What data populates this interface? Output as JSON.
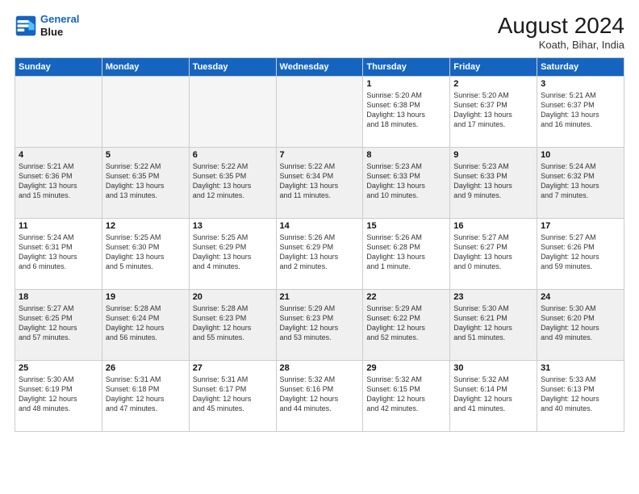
{
  "header": {
    "logo_line1": "General",
    "logo_line2": "Blue",
    "month_year": "August 2024",
    "location": "Koath, Bihar, India"
  },
  "weekdays": [
    "Sunday",
    "Monday",
    "Tuesday",
    "Wednesday",
    "Thursday",
    "Friday",
    "Saturday"
  ],
  "weeks": [
    [
      {
        "day": "",
        "info": ""
      },
      {
        "day": "",
        "info": ""
      },
      {
        "day": "",
        "info": ""
      },
      {
        "day": "",
        "info": ""
      },
      {
        "day": "1",
        "info": "Sunrise: 5:20 AM\nSunset: 6:38 PM\nDaylight: 13 hours\nand 18 minutes."
      },
      {
        "day": "2",
        "info": "Sunrise: 5:20 AM\nSunset: 6:37 PM\nDaylight: 13 hours\nand 17 minutes."
      },
      {
        "day": "3",
        "info": "Sunrise: 5:21 AM\nSunset: 6:37 PM\nDaylight: 13 hours\nand 16 minutes."
      }
    ],
    [
      {
        "day": "4",
        "info": "Sunrise: 5:21 AM\nSunset: 6:36 PM\nDaylight: 13 hours\nand 15 minutes."
      },
      {
        "day": "5",
        "info": "Sunrise: 5:22 AM\nSunset: 6:35 PM\nDaylight: 13 hours\nand 13 minutes."
      },
      {
        "day": "6",
        "info": "Sunrise: 5:22 AM\nSunset: 6:35 PM\nDaylight: 13 hours\nand 12 minutes."
      },
      {
        "day": "7",
        "info": "Sunrise: 5:22 AM\nSunset: 6:34 PM\nDaylight: 13 hours\nand 11 minutes."
      },
      {
        "day": "8",
        "info": "Sunrise: 5:23 AM\nSunset: 6:33 PM\nDaylight: 13 hours\nand 10 minutes."
      },
      {
        "day": "9",
        "info": "Sunrise: 5:23 AM\nSunset: 6:33 PM\nDaylight: 13 hours\nand 9 minutes."
      },
      {
        "day": "10",
        "info": "Sunrise: 5:24 AM\nSunset: 6:32 PM\nDaylight: 13 hours\nand 7 minutes."
      }
    ],
    [
      {
        "day": "11",
        "info": "Sunrise: 5:24 AM\nSunset: 6:31 PM\nDaylight: 13 hours\nand 6 minutes."
      },
      {
        "day": "12",
        "info": "Sunrise: 5:25 AM\nSunset: 6:30 PM\nDaylight: 13 hours\nand 5 minutes."
      },
      {
        "day": "13",
        "info": "Sunrise: 5:25 AM\nSunset: 6:29 PM\nDaylight: 13 hours\nand 4 minutes."
      },
      {
        "day": "14",
        "info": "Sunrise: 5:26 AM\nSunset: 6:29 PM\nDaylight: 13 hours\nand 2 minutes."
      },
      {
        "day": "15",
        "info": "Sunrise: 5:26 AM\nSunset: 6:28 PM\nDaylight: 13 hours\nand 1 minute."
      },
      {
        "day": "16",
        "info": "Sunrise: 5:27 AM\nSunset: 6:27 PM\nDaylight: 13 hours\nand 0 minutes."
      },
      {
        "day": "17",
        "info": "Sunrise: 5:27 AM\nSunset: 6:26 PM\nDaylight: 12 hours\nand 59 minutes."
      }
    ],
    [
      {
        "day": "18",
        "info": "Sunrise: 5:27 AM\nSunset: 6:25 PM\nDaylight: 12 hours\nand 57 minutes."
      },
      {
        "day": "19",
        "info": "Sunrise: 5:28 AM\nSunset: 6:24 PM\nDaylight: 12 hours\nand 56 minutes."
      },
      {
        "day": "20",
        "info": "Sunrise: 5:28 AM\nSunset: 6:23 PM\nDaylight: 12 hours\nand 55 minutes."
      },
      {
        "day": "21",
        "info": "Sunrise: 5:29 AM\nSunset: 6:23 PM\nDaylight: 12 hours\nand 53 minutes."
      },
      {
        "day": "22",
        "info": "Sunrise: 5:29 AM\nSunset: 6:22 PM\nDaylight: 12 hours\nand 52 minutes."
      },
      {
        "day": "23",
        "info": "Sunrise: 5:30 AM\nSunset: 6:21 PM\nDaylight: 12 hours\nand 51 minutes."
      },
      {
        "day": "24",
        "info": "Sunrise: 5:30 AM\nSunset: 6:20 PM\nDaylight: 12 hours\nand 49 minutes."
      }
    ],
    [
      {
        "day": "25",
        "info": "Sunrise: 5:30 AM\nSunset: 6:19 PM\nDaylight: 12 hours\nand 48 minutes."
      },
      {
        "day": "26",
        "info": "Sunrise: 5:31 AM\nSunset: 6:18 PM\nDaylight: 12 hours\nand 47 minutes."
      },
      {
        "day": "27",
        "info": "Sunrise: 5:31 AM\nSunset: 6:17 PM\nDaylight: 12 hours\nand 45 minutes."
      },
      {
        "day": "28",
        "info": "Sunrise: 5:32 AM\nSunset: 6:16 PM\nDaylight: 12 hours\nand 44 minutes."
      },
      {
        "day": "29",
        "info": "Sunrise: 5:32 AM\nSunset: 6:15 PM\nDaylight: 12 hours\nand 42 minutes."
      },
      {
        "day": "30",
        "info": "Sunrise: 5:32 AM\nSunset: 6:14 PM\nDaylight: 12 hours\nand 41 minutes."
      },
      {
        "day": "31",
        "info": "Sunrise: 5:33 AM\nSunset: 6:13 PM\nDaylight: 12 hours\nand 40 minutes."
      }
    ]
  ]
}
